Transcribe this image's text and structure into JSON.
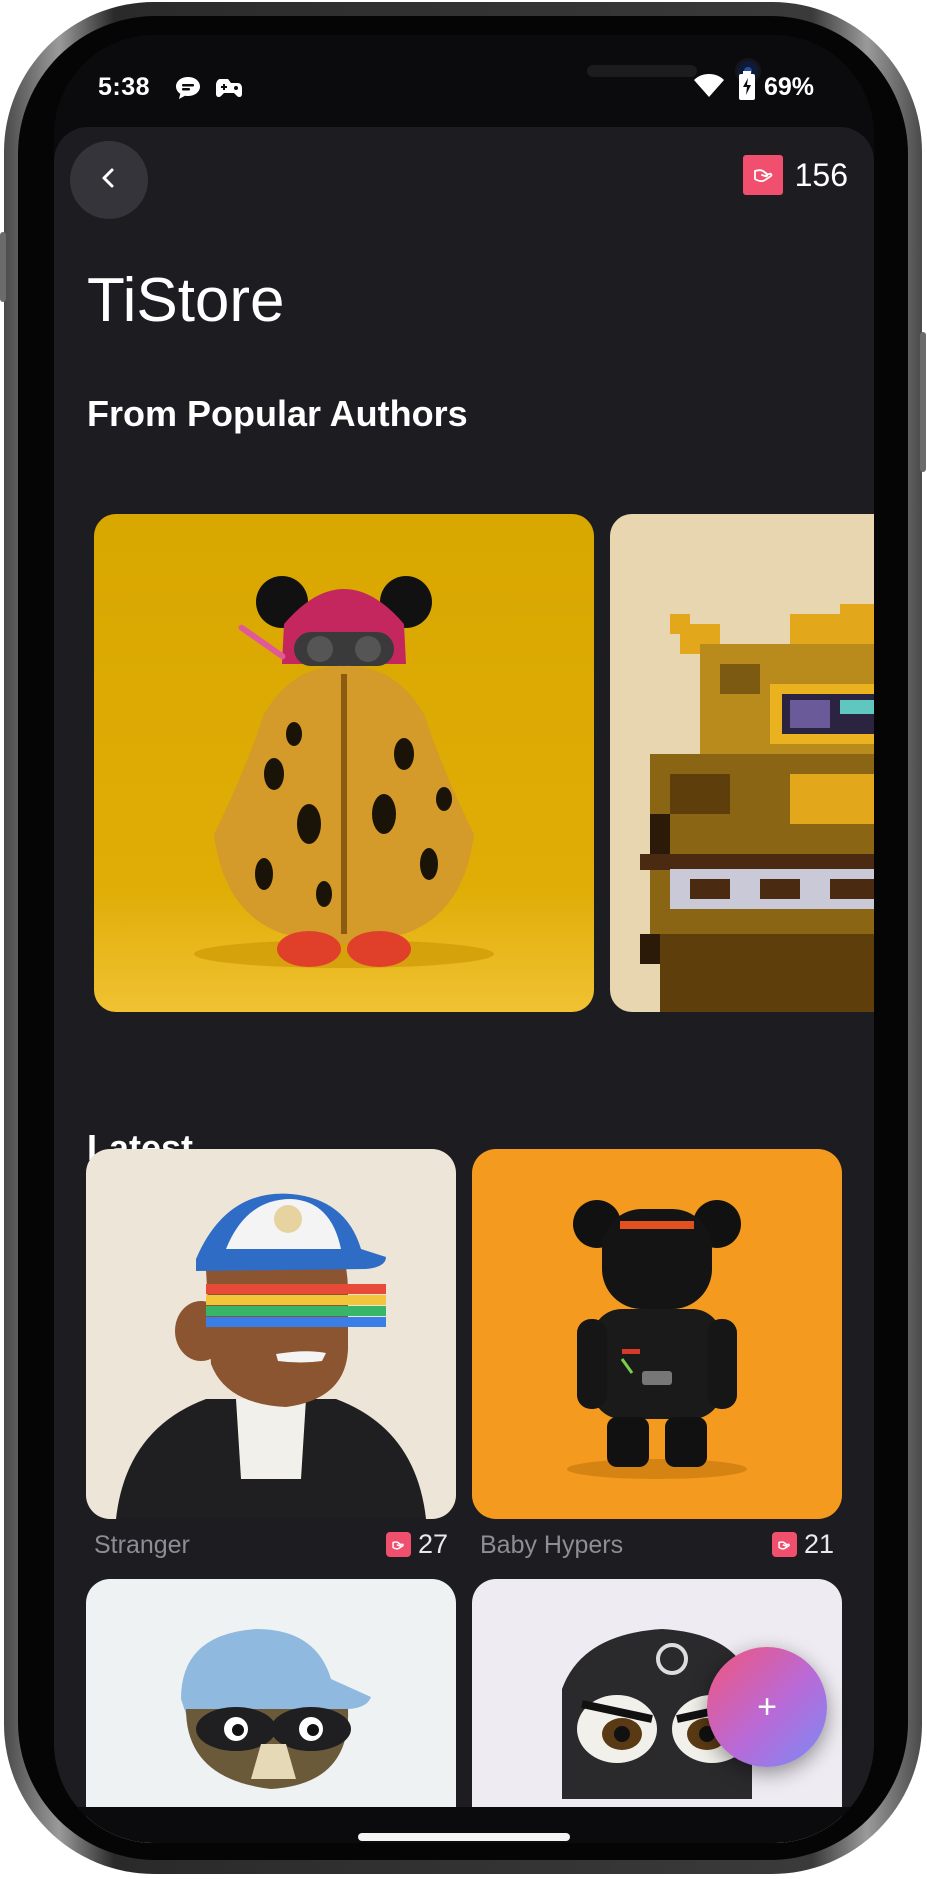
{
  "status_bar": {
    "time": "5:38",
    "battery": "69%",
    "icons": [
      "chat-bubble-icon",
      "game-controller-icon",
      "wifi-icon",
      "battery-charging-icon"
    ]
  },
  "header": {
    "back_icon": "chevron-left-icon",
    "coin_icon": "hand-coin-icon",
    "coin_count": "156"
  },
  "page_title": "TiStore",
  "sections": {
    "popular": {
      "title": "From Popular Authors"
    },
    "latest": {
      "title": "Latest"
    }
  },
  "latest_items": [
    {
      "name": "Stranger",
      "likes": "27"
    },
    {
      "name": "Baby Hypers",
      "likes": "21"
    }
  ],
  "fab": {
    "label": "+"
  },
  "colors": {
    "background": "#1d1c21",
    "accent_coin": "#f0506e",
    "card_yellow": "#d9a904",
    "card_beige": "#e8d6b0",
    "card_cream": "#ece5d8",
    "card_orange": "#f39a1f",
    "card_light_blue": "#eef2f3",
    "card_lavender": "#eeebf2"
  }
}
